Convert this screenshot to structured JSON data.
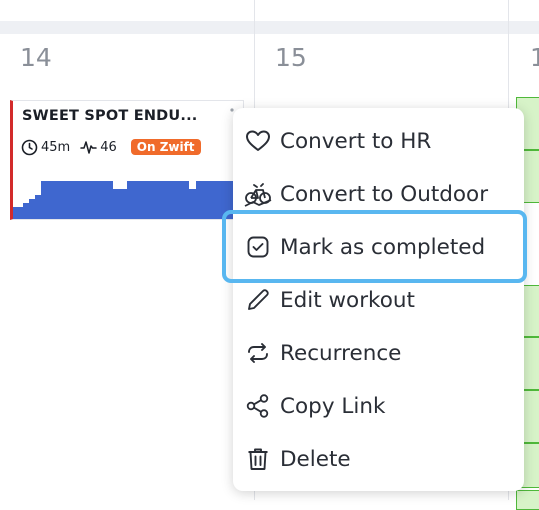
{
  "calendar": {
    "days": [
      {
        "number": "14"
      },
      {
        "number": "15"
      },
      {
        "number": "1"
      }
    ]
  },
  "workout": {
    "title": "SWEET SPOT ENDU...",
    "duration": "45m",
    "load": "46",
    "badge": "On Zwift",
    "badge_color": "#f06b2b",
    "accent_color": "#d22a2a",
    "chart_color": "#3f67cf"
  },
  "menu": {
    "items": [
      {
        "label": "Convert to HR",
        "icon": "heart-icon"
      },
      {
        "label": "Convert to Outdoor",
        "icon": "outdoor-bike-icon"
      },
      {
        "label": "Mark as completed",
        "icon": "checkbox-icon"
      },
      {
        "label": "Edit workout",
        "icon": "pencil-icon"
      },
      {
        "label": "Recurrence",
        "icon": "repeat-icon"
      },
      {
        "label": "Copy Link",
        "icon": "share-icon"
      },
      {
        "label": "Delete",
        "icon": "trash-icon"
      }
    ],
    "highlight_color": "#59b7f0"
  }
}
